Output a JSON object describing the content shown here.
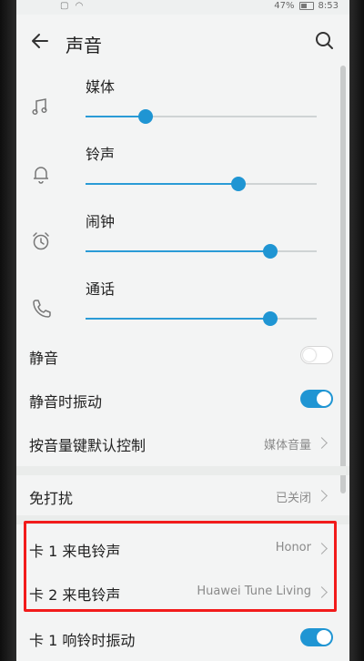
{
  "status_bar": {
    "battery": "47%",
    "time": "8:53"
  },
  "header": {
    "title": "声音"
  },
  "volumes": [
    {
      "label": "媒体",
      "level": 0.26,
      "icon": "music-note-icon"
    },
    {
      "label": "铃声",
      "level": 0.66,
      "icon": "bell-icon"
    },
    {
      "label": "闹钟",
      "level": 0.8,
      "icon": "alarm-clock-icon"
    },
    {
      "label": "通话",
      "level": 0.8,
      "icon": "phone-icon"
    }
  ],
  "settings": {
    "mute": {
      "label": "静音",
      "state": "off"
    },
    "mute_vibrate": {
      "label": "静音时振动",
      "state": "on"
    },
    "volume_key_default": {
      "label": "按音量键默认控制",
      "value": "媒体音量"
    },
    "do_not_disturb": {
      "label": "免打扰",
      "value": "已关闭"
    },
    "sim1_ringtone": {
      "label": "卡 1 来电铃声",
      "value": "Honor"
    },
    "sim2_ringtone": {
      "label": "卡 2 来电铃声",
      "value": "Huawei Tune Living"
    },
    "sim1_vibrate": {
      "label": "卡 1 响铃时振动",
      "state": "on"
    }
  },
  "colors": {
    "accent": "#1f95d3",
    "highlight": "#f21b1b",
    "background": "#f3f4f4"
  }
}
